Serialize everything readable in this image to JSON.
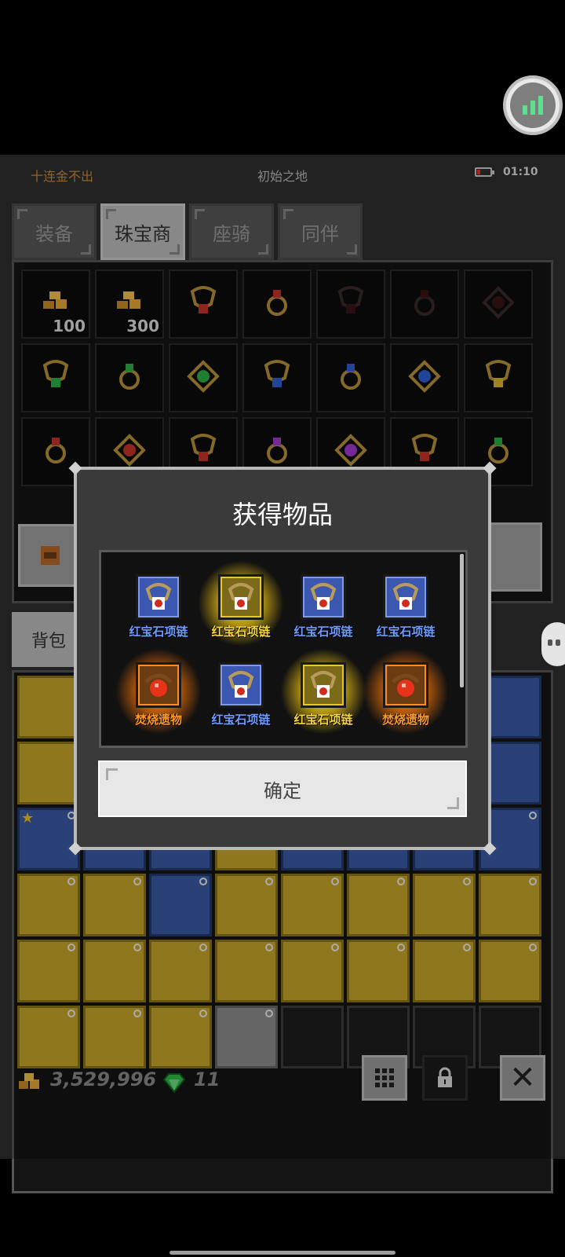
{
  "status_bar": {
    "left_text": "十连金不出",
    "location": "初始之地",
    "time": "01:10"
  },
  "tabs": [
    {
      "label": "装备",
      "active": false
    },
    {
      "label": "珠宝商",
      "active": true
    },
    {
      "label": "座骑",
      "active": false
    },
    {
      "label": "同伴",
      "active": false
    }
  ],
  "shop": {
    "items": [
      {
        "icon": "gold-pile-icon",
        "qty": "100"
      },
      {
        "icon": "gold-pile-icon",
        "qty": "300"
      },
      {
        "icon": "necklace-icon",
        "qty": ""
      },
      {
        "icon": "ring-icon",
        "qty": ""
      },
      {
        "icon": "necklace-dark-icon",
        "qty": ""
      },
      {
        "icon": "ring-dark-icon",
        "qty": ""
      },
      {
        "icon": "amulet-dark-icon",
        "qty": ""
      },
      {
        "icon": "green-necklace-icon",
        "qty": ""
      },
      {
        "icon": "green-ring-icon",
        "qty": ""
      },
      {
        "icon": "green-amulet-icon",
        "qty": ""
      },
      {
        "icon": "blue-necklace-icon",
        "qty": ""
      },
      {
        "icon": "blue-ring-icon",
        "qty": ""
      },
      {
        "icon": "blue-amulet-icon",
        "qty": ""
      },
      {
        "icon": "yellow-necklace-icon",
        "qty": ""
      },
      {
        "icon": "gold-ring-icon",
        "qty": ""
      },
      {
        "icon": "gold-amulet-icon",
        "qty": ""
      },
      {
        "icon": "necklace-icon",
        "qty": ""
      },
      {
        "icon": "purple-ring-icon",
        "qty": ""
      },
      {
        "icon": "purple-amulet-icon",
        "qty": ""
      },
      {
        "icon": "necklace-icon",
        "qty": ""
      },
      {
        "icon": "green-ring-icon",
        "qty": ""
      }
    ]
  },
  "bag_tab": {
    "label": "背包"
  },
  "wallet": {
    "gold": "3,529,996",
    "gems": "11"
  },
  "dialog": {
    "title": "获得物品",
    "confirm_label": "确定",
    "items": [
      {
        "name": "红宝石项链",
        "rarity": "blue"
      },
      {
        "name": "红宝石项链",
        "rarity": "gold"
      },
      {
        "name": "红宝石项链",
        "rarity": "blue"
      },
      {
        "name": "红宝石项链",
        "rarity": "blue"
      },
      {
        "name": "焚烧遗物",
        "rarity": "orange"
      },
      {
        "name": "红宝石项链",
        "rarity": "blue"
      },
      {
        "name": "红宝石项链",
        "rarity": "gold"
      },
      {
        "name": "焚烧遗物",
        "rarity": "orange"
      }
    ]
  },
  "colors": {
    "rarity_blue": "#6f9bff",
    "rarity_gold": "#f5d63c",
    "rarity_orange": "#ff9a24",
    "status_left": "#c98b3a"
  }
}
